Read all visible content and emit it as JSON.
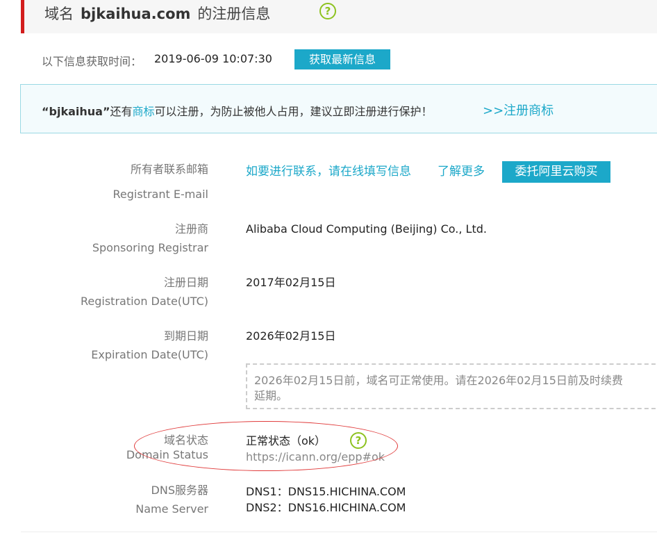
{
  "header": {
    "title_prefix": "域名",
    "domain": "bjkaihua.com",
    "title_suffix": "的注册信息",
    "help_icon": "?"
  },
  "fetch": {
    "label": "以下信息获取时间：",
    "time": "2019-06-09 10:07:30",
    "button": "获取最新信息"
  },
  "notice": {
    "quote_open": "“",
    "name": "bjkaihua",
    "quote_close": "”",
    "text_before": "还有",
    "trademark_link": "商标",
    "text_after": "可以注册，为防止被他人占用，建议立即注册进行保护！",
    "register_link": ">>注册商标"
  },
  "rows": {
    "email": {
      "label_cn": "所有者联系邮箱",
      "label_en": "Registrant E-mail",
      "contact_link": "如要进行联系，请在线填写信息",
      "learn_more": "了解更多",
      "button": "委托阿里云购买"
    },
    "registrar": {
      "label_cn": "注册商",
      "label_en": "Sponsoring Registrar",
      "value": "Alibaba Cloud Computing (Beijing) Co., Ltd."
    },
    "reg_date": {
      "label_cn": "注册日期",
      "label_en": "Registration Date(UTC)",
      "value": "2017年02月15日"
    },
    "exp_date": {
      "label_cn": "到期日期",
      "label_en": "Expiration Date(UTC)",
      "value": "2026年02月15日",
      "note_line1": "2026年02月15日前，域名可正常使用。请在2026年02月15日前及时续费",
      "note_line2": "延期。"
    },
    "status": {
      "label_cn": "域名状态",
      "label_en": "Domain Status",
      "value": "正常状态（ok）",
      "help_icon": "?",
      "url": "https://icann.org/epp#ok"
    },
    "dns": {
      "label_cn": "DNS服务器",
      "label_en": "Name Server",
      "dns1": "DNS1：DNS15.HICHINA.COM",
      "dns2": "DNS2：DNS16.HICHINA.COM"
    }
  },
  "colors": {
    "accent_red": "#d21d1d",
    "brand_blue": "#1ca8c9",
    "help_green": "#8dc21f",
    "annotation_red": "#e03a3a"
  }
}
